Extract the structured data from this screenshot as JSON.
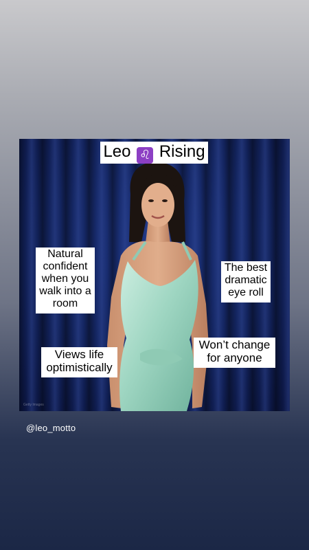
{
  "story": {
    "title_before": "Leo",
    "title_symbol": "♌",
    "title_after": "Rising",
    "captions": {
      "left_top": "Natural confident when you walk into a room",
      "right_top": "The best dramatic eye roll",
      "left_bottom": "Views life optimistically",
      "right_bottom": "Won’t change for anyone"
    },
    "watermark": "Getty Images"
  },
  "handle": "@leo_motto",
  "colors": {
    "curtain": "#13245e",
    "dress": "#a8dcc8",
    "leo_badge": "#8c3fc4"
  }
}
